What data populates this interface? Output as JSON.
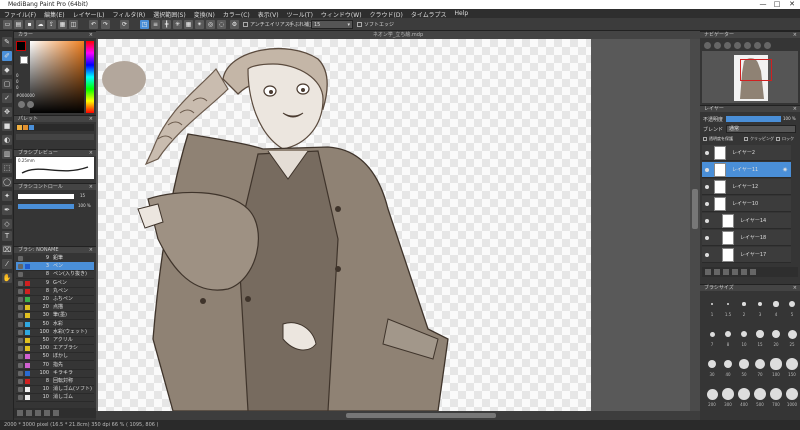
{
  "app": {
    "title": "MediBang Paint Pro (64bit)",
    "window_controls": [
      "—",
      "□",
      "✕"
    ]
  },
  "menu": [
    "ファイル(F)",
    "編集(E)",
    "レイヤー(L)",
    "フィルタ(R)",
    "選択範囲(S)",
    "変換(N)",
    "カラー(C)",
    "表示(V)",
    "ツール(T)",
    "ウィンドウ(W)",
    "クラウド(D)",
    "タイムラプス",
    "Help"
  ],
  "toolbar": {
    "antialias_label": "アンチエイリアス",
    "stabilizer_label": "手ぶれ補正",
    "stabilizer_value": "15",
    "soft_edge_label": "ソフトエッジ"
  },
  "document": {
    "tab_title": "ネオン学_立ち絵.mdp"
  },
  "panels": {
    "color": {
      "title": "カラー",
      "hex_value": "#000000",
      "r": "0",
      "g": "0",
      "b": "0"
    },
    "palette": {
      "title": "パレット"
    },
    "brush_preview": {
      "title": "ブラシプレビュー",
      "size_text": "0.25mm"
    },
    "brush_control": {
      "title": "ブラシコントロール",
      "size_value": "15",
      "opacity_value": "100 %"
    },
    "brush": {
      "title": "ブラシ: NONAME"
    },
    "navigator": {
      "title": "ナビゲーター"
    },
    "layer": {
      "title": "レイヤー",
      "opacity_label": "不透明度",
      "opacity_value": "100 %",
      "blend_label": "ブレンド",
      "blend_value": "通常",
      "protect_alpha": "透明度を保護",
      "clipping": "クリッピング",
      "lock": "ロック"
    },
    "brush_size": {
      "title": "ブラシサイズ"
    }
  },
  "brushes": [
    {
      "size": "9",
      "name": "鉛筆",
      "color": "#333333"
    },
    {
      "size": "3",
      "name": "ペン",
      "color": "#1e5bd0",
      "selected": true
    },
    {
      "size": "8",
      "name": "ペン(入り抜き)",
      "color": "#333333"
    },
    {
      "size": "9",
      "name": "Gペン",
      "color": "#d02020"
    },
    {
      "size": "8",
      "name": "丸ペン",
      "color": "#d02020"
    },
    {
      "size": "20",
      "name": "ふちペン",
      "color": "#3cb04a"
    },
    {
      "size": "20",
      "name": "点描",
      "color": "#e0c020"
    },
    {
      "size": "30",
      "name": "筆(墨)",
      "color": "#e0c020"
    },
    {
      "size": "50",
      "name": "水彩",
      "color": "#2fa8e0"
    },
    {
      "size": "100",
      "name": "水彩(ウェット)",
      "color": "#2fa8e0"
    },
    {
      "size": "50",
      "name": "アクリル",
      "color": "#e0c020"
    },
    {
      "size": "100",
      "name": "エアブラシ",
      "color": "#e0c020"
    },
    {
      "size": "50",
      "name": "ぼかし",
      "color": "#d060d0"
    },
    {
      "size": "70",
      "name": "指先",
      "color": "#d060d0"
    },
    {
      "size": "100",
      "name": "キラキラ",
      "color": "#2a6ad0"
    },
    {
      "size": "8",
      "name": "回転対称",
      "color": "#d02020"
    },
    {
      "size": "10",
      "name": "消しゴム(ソフト)",
      "color": "#eeeeee"
    },
    {
      "size": "10",
      "name": "消しゴム",
      "color": "#eeeeee"
    }
  ],
  "layers": [
    {
      "name": "レイヤー2",
      "indent": 1
    },
    {
      "name": "レイヤー11",
      "indent": 1,
      "selected": true
    },
    {
      "name": "レイヤー12",
      "indent": 1
    },
    {
      "name": "レイヤー10",
      "indent": 1
    },
    {
      "name": "レイヤー14",
      "indent": 2
    },
    {
      "name": "レイヤー18",
      "indent": 2
    },
    {
      "name": "レイヤー17",
      "indent": 2
    }
  ],
  "brush_sizes": [
    "1",
    "1.5",
    "2",
    "3",
    "4",
    "5",
    "7",
    "8",
    "10",
    "15",
    "20",
    "25",
    "30",
    "40",
    "50",
    "70",
    "100",
    "150",
    "200",
    "300",
    "400",
    "500",
    "700",
    "1000"
  ],
  "status": {
    "text": "2000 * 3000 pixel  (16.5 * 21.8cm)  350 dpi  66 %  ( 1095, 806 )"
  },
  "colors": {
    "accent": "#4a8fd8",
    "panel_bg": "#353535",
    "canvas_bg": "#595959",
    "selected_nav_box": "#d02020"
  },
  "icons": [
    "pen-icon",
    "brush-icon",
    "eraser-icon",
    "select-icon",
    "move-icon",
    "fill-icon",
    "text-icon",
    "eyedropper-icon",
    "hand-icon",
    "undo-icon",
    "redo-icon",
    "zoom-in-icon",
    "zoom-out-icon",
    "new-layer-icon",
    "delete-layer-icon",
    "folder-icon"
  ]
}
